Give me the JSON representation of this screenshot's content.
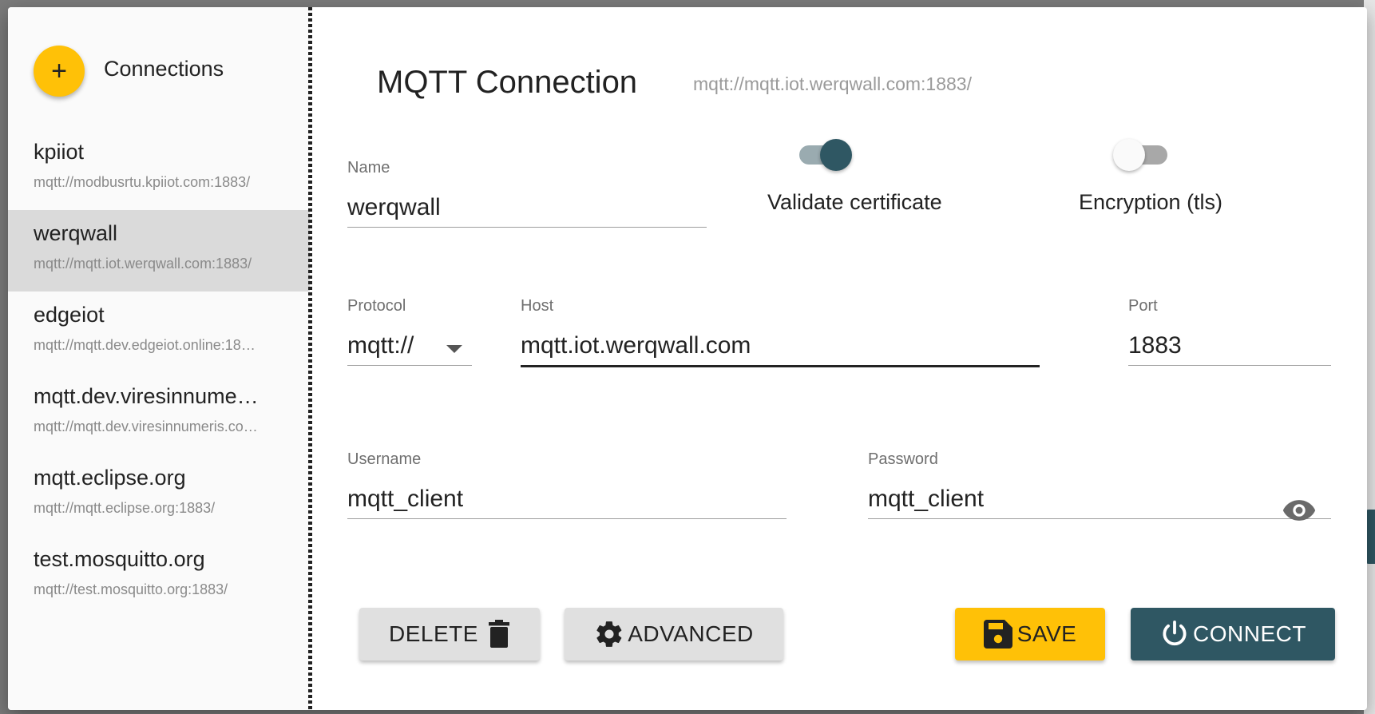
{
  "sidebar": {
    "title": "Connections",
    "add_icon": "plus-icon",
    "connections": [
      {
        "name": "kpiiot",
        "url": "mqtt://modbusrtu.kpiiot.com:1883/",
        "selected": false
      },
      {
        "name": "werqwall",
        "url": "mqtt://mqtt.iot.werqwall.com:1883/",
        "selected": true
      },
      {
        "name": "edgeiot",
        "url": "mqtt://mqtt.dev.edgeiot.online:18…",
        "selected": false
      },
      {
        "name": "mqtt.dev.viresinnume…",
        "url": "mqtt://mqtt.dev.viresinnumeris.co…",
        "selected": false
      },
      {
        "name": "mqtt.eclipse.org",
        "url": "mqtt://mqtt.eclipse.org:1883/",
        "selected": false
      },
      {
        "name": "test.mosquitto.org",
        "url": "mqtt://test.mosquitto.org:1883/",
        "selected": false
      }
    ]
  },
  "main": {
    "title": "MQTT Connection",
    "subtitle": "mqtt://mqtt.iot.werqwall.com:1883/",
    "name": {
      "label": "Name",
      "value": "werqwall"
    },
    "validate_certificate": {
      "label": "Validate certificate",
      "on": true
    },
    "encryption": {
      "label": "Encryption (tls)",
      "on": false
    },
    "protocol": {
      "label": "Protocol",
      "value": "mqtt://"
    },
    "host": {
      "label": "Host",
      "value": "mqtt.iot.werqwall.com"
    },
    "port": {
      "label": "Port",
      "value": "1883"
    },
    "username": {
      "label": "Username",
      "value": "mqtt_client"
    },
    "password": {
      "label": "Password",
      "value": "mqtt_client",
      "visibility_icon": "eye-icon"
    },
    "buttons": {
      "delete": {
        "label": "DELETE",
        "icon": "trash-icon"
      },
      "advanced": {
        "label": "ADVANCED",
        "icon": "gear-icon"
      },
      "save": {
        "label": "SAVE",
        "icon": "floppy-disk-icon"
      },
      "connect": {
        "label": "CONNECT",
        "icon": "power-icon"
      }
    }
  },
  "colors": {
    "accent_yellow": "#ffc107",
    "accent_teal": "#2f5763",
    "selected_item_bg": "#dadada"
  }
}
